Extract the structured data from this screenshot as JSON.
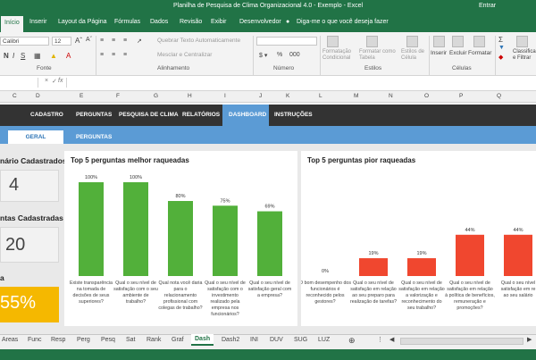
{
  "window": {
    "title": "Planilha de Pesquisa de Clima Organizacional 4.0 - Exemplo  -  Excel",
    "signin": "Entrar"
  },
  "ribbon_tabs": [
    "Início",
    "Inserir",
    "Layout da Página",
    "Fórmulas",
    "Dados",
    "Revisão",
    "Exibir",
    "Desenvolvedor"
  ],
  "tell_me": "Diga-me o que você deseja fazer",
  "ribbon": {
    "font_name": "Calibri",
    "font_size": "12",
    "wrap_text": "Quebrar Texto Automaticamente",
    "merge_center": "Mesclar e Centralizar",
    "conditional_formatting": "Formatação Condicional",
    "format_as_table": "Formatar como Tabela",
    "cell_styles": "Estilos de Célula",
    "insert": "Inserir",
    "delete": "Excluir",
    "format": "Formatar",
    "sort_filter": "Classificar e Filtrar",
    "groups": {
      "font": "Fonte",
      "alignment": "Alinhamento",
      "number": "Número",
      "styles": "Estilos",
      "cells": "Células"
    }
  },
  "column_headers": [
    "C",
    "D",
    "E",
    "F",
    "G",
    "H",
    "I",
    "J",
    "K",
    "L",
    "M",
    "N",
    "O",
    "P",
    "Q"
  ],
  "dashboard": {
    "nav": [
      "CADASTRO",
      "PERGUNTAS",
      "PESQUISA DE CLIMA",
      "RELATÓRIOS",
      "DASHBOARD",
      "INSTRUÇÕES"
    ],
    "subnav": [
      "GERAL",
      "PERGUNTAS"
    ],
    "kpis": [
      {
        "label": "nário Cadastrados",
        "value": "4"
      },
      {
        "label": "ntas Cadastradas",
        "value": "20"
      },
      {
        "label": "a",
        "value": "55%"
      }
    ]
  },
  "chart_data": [
    {
      "type": "bar",
      "title": "Top 5 perguntas melhor raqueadas",
      "categories": [
        [
          "Existe transparência",
          "na tomada de",
          "decisões de seus",
          "superiores?"
        ],
        [
          "Qual o seu nível de",
          "satisfação com o seu",
          "ambiente de",
          "trabalho?"
        ],
        [
          "Qual nota você daria",
          "para o",
          "relacionamento",
          "profissional com",
          "colegas de trabalho?"
        ],
        [
          "Qual o seu nível de",
          "satisfação com o",
          "investimento",
          "realizado pela",
          "empresa nos",
          "funcionários?"
        ],
        [
          "Qual o seu nível de",
          "satisfação geral com",
          "a empresa?"
        ]
      ],
      "values": [
        100,
        100,
        80,
        75,
        69
      ],
      "labels": [
        "100%",
        "100%",
        "80%",
        "75%",
        "69%"
      ],
      "color": "#52b03a",
      "ylim": [
        0,
        100
      ]
    },
    {
      "type": "bar",
      "title": "Top 5 perguntas pior raqueadas",
      "categories": [
        [
          "O bom desempenho dos",
          "funcionários é",
          "reconhecido pelos",
          "gestores?"
        ],
        [
          "Qual o seu nível de",
          "satisfação em relação",
          "ao seu preparo para",
          "realização de tarefas?"
        ],
        [
          "Qual o seu nível de",
          "satisfação em relação",
          "a valorização e",
          "reconhecimento do",
          "seu trabalho?"
        ],
        [
          "Qual o seu nível de",
          "satisfação em relação",
          "à política de benefícios,",
          "remuneração e",
          "promoções?"
        ],
        [
          "Qual o seu nível",
          "satisfação em re",
          "ao seu salário"
        ]
      ],
      "values": [
        0,
        19,
        19,
        44,
        44
      ],
      "labels": [
        "0%",
        "19%",
        "19%",
        "44%",
        "44%"
      ],
      "color": "#f0472f",
      "ylim": [
        0,
        100
      ]
    }
  ],
  "sheet_tabs": [
    "Areas",
    "Func",
    "Resp",
    "Perg",
    "Pesq",
    "Sat",
    "Rank",
    "Graf",
    "Dash",
    "Dash2",
    "INI",
    "DUV",
    "SUG",
    "LUZ"
  ],
  "active_sheet": "Dash",
  "colors": {
    "excel_green": "#217346",
    "nav_dark": "#333333",
    "nav_blue": "#5b9bd5",
    "kpi_yellow": "#f5b800"
  }
}
